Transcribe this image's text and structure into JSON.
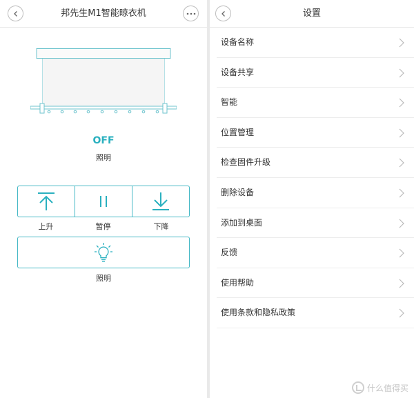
{
  "left": {
    "title": "邦先生M1智能晾衣机",
    "status_value": "OFF",
    "status_label": "照明",
    "controls": [
      {
        "label": "上升",
        "icon": "arrow-up-bar-icon"
      },
      {
        "label": "暂停",
        "icon": "pause-icon"
      },
      {
        "label": "下降",
        "icon": "arrow-down-bar-icon"
      }
    ],
    "light_label": "照明",
    "accent": "#45b8c5"
  },
  "right": {
    "title": "设置",
    "menu": [
      {
        "label": "设备名称"
      },
      {
        "label": "设备共享"
      },
      {
        "label": "智能"
      },
      {
        "label": "位置管理"
      },
      {
        "label": "检查固件升级"
      },
      {
        "label": "删除设备"
      },
      {
        "label": "添加到桌面"
      },
      {
        "label": "反馈"
      },
      {
        "label": "使用帮助"
      },
      {
        "label": "使用条款和隐私政策"
      }
    ]
  },
  "watermark": {
    "text": "什么值得买"
  }
}
